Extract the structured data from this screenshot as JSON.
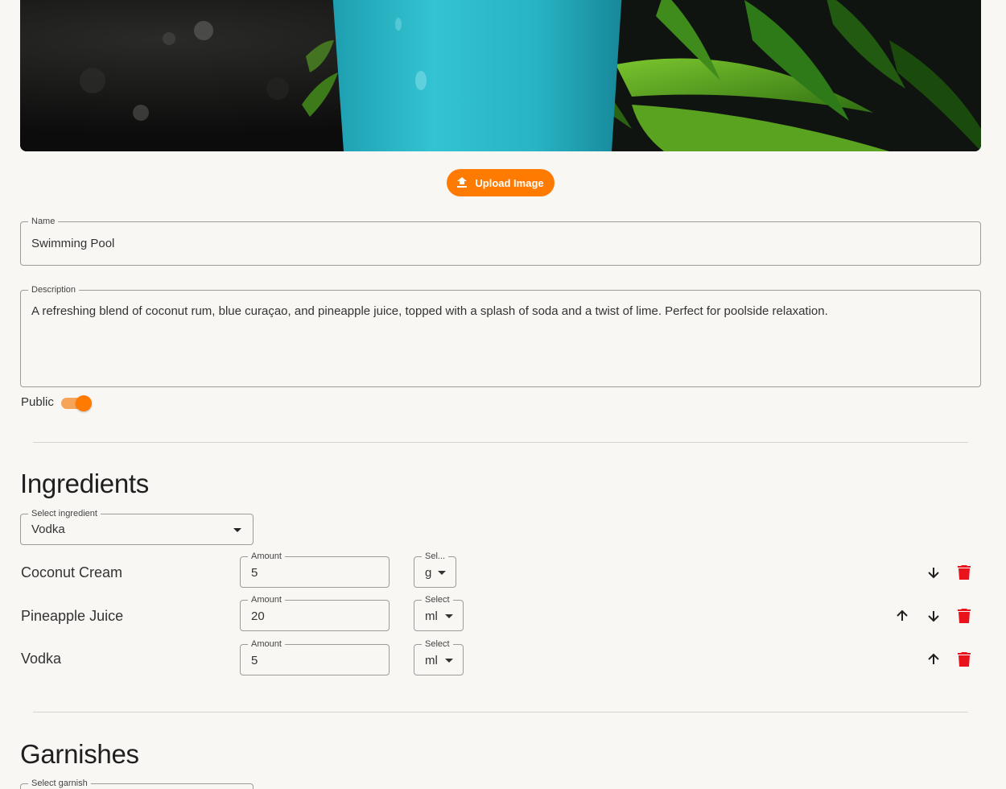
{
  "upload": {
    "label": "Upload Image"
  },
  "name_field": {
    "label": "Name",
    "value": "Swimming Pool"
  },
  "description_field": {
    "label": "Description",
    "value": "A refreshing blend of coconut rum, blue curaçao, and pineapple juice, topped with a splash of soda and a twist of lime. Perfect for poolside relaxation."
  },
  "public_toggle": {
    "label": "Public",
    "checked": true
  },
  "ingredients": {
    "heading": "Ingredients",
    "select": {
      "label": "Select ingredient",
      "value": "Vodka"
    },
    "items": [
      {
        "name": "Coconut Cream",
        "amount_label": "Amount",
        "amount": "5",
        "unit_label": "Sel...",
        "unit": "g",
        "can_move_up": false,
        "can_move_down": true
      },
      {
        "name": "Pineapple Juice",
        "amount_label": "Amount",
        "amount": "20",
        "unit_label": "Select",
        "unit": "ml",
        "can_move_up": true,
        "can_move_down": true
      },
      {
        "name": "Vodka",
        "amount_label": "Amount",
        "amount": "5",
        "unit_label": "Select",
        "unit": "ml",
        "can_move_up": true,
        "can_move_down": false
      }
    ]
  },
  "garnishes": {
    "heading": "Garnishes",
    "select": {
      "label": "Select garnish",
      "value": ""
    }
  },
  "colors": {
    "accent": "#ff7a00",
    "delete": "#e8131b",
    "hero_cup": "#27b9c9"
  }
}
